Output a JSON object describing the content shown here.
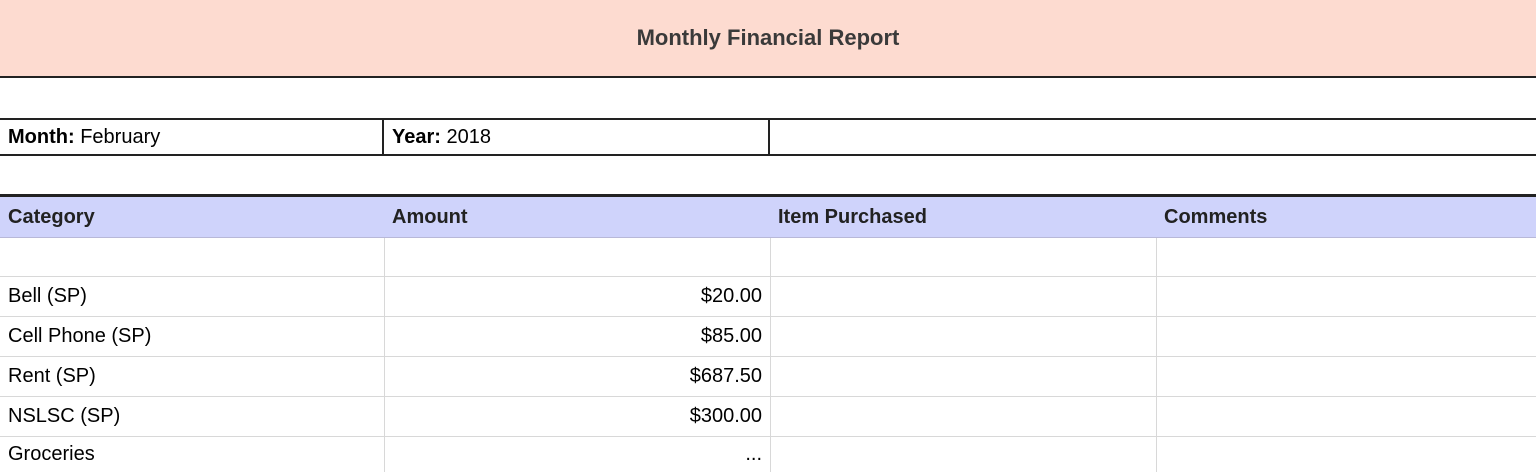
{
  "title": "Monthly Financial Report",
  "meta": {
    "month_label": "Month:",
    "month_value": "February",
    "year_label": "Year:",
    "year_value": "2018"
  },
  "table": {
    "headers": [
      "Category",
      "Amount",
      "Item Purchased",
      "Comments"
    ],
    "rows": [
      {
        "category": "",
        "amount": "",
        "item": "",
        "comments": ""
      },
      {
        "category": "Bell (SP)",
        "amount": "$20.00",
        "item": "",
        "comments": ""
      },
      {
        "category": "Cell Phone (SP)",
        "amount": "$85.00",
        "item": "",
        "comments": ""
      },
      {
        "category": "Rent (SP)",
        "amount": "$687.50",
        "item": "",
        "comments": ""
      },
      {
        "category": "NSLSC (SP)",
        "amount": "$300.00",
        "item": "",
        "comments": ""
      },
      {
        "category": "Groceries",
        "amount": "...",
        "item": "",
        "comments": ""
      }
    ]
  },
  "colors": {
    "title_background": "#fddbd0",
    "header_background": "#cfd3fb"
  }
}
